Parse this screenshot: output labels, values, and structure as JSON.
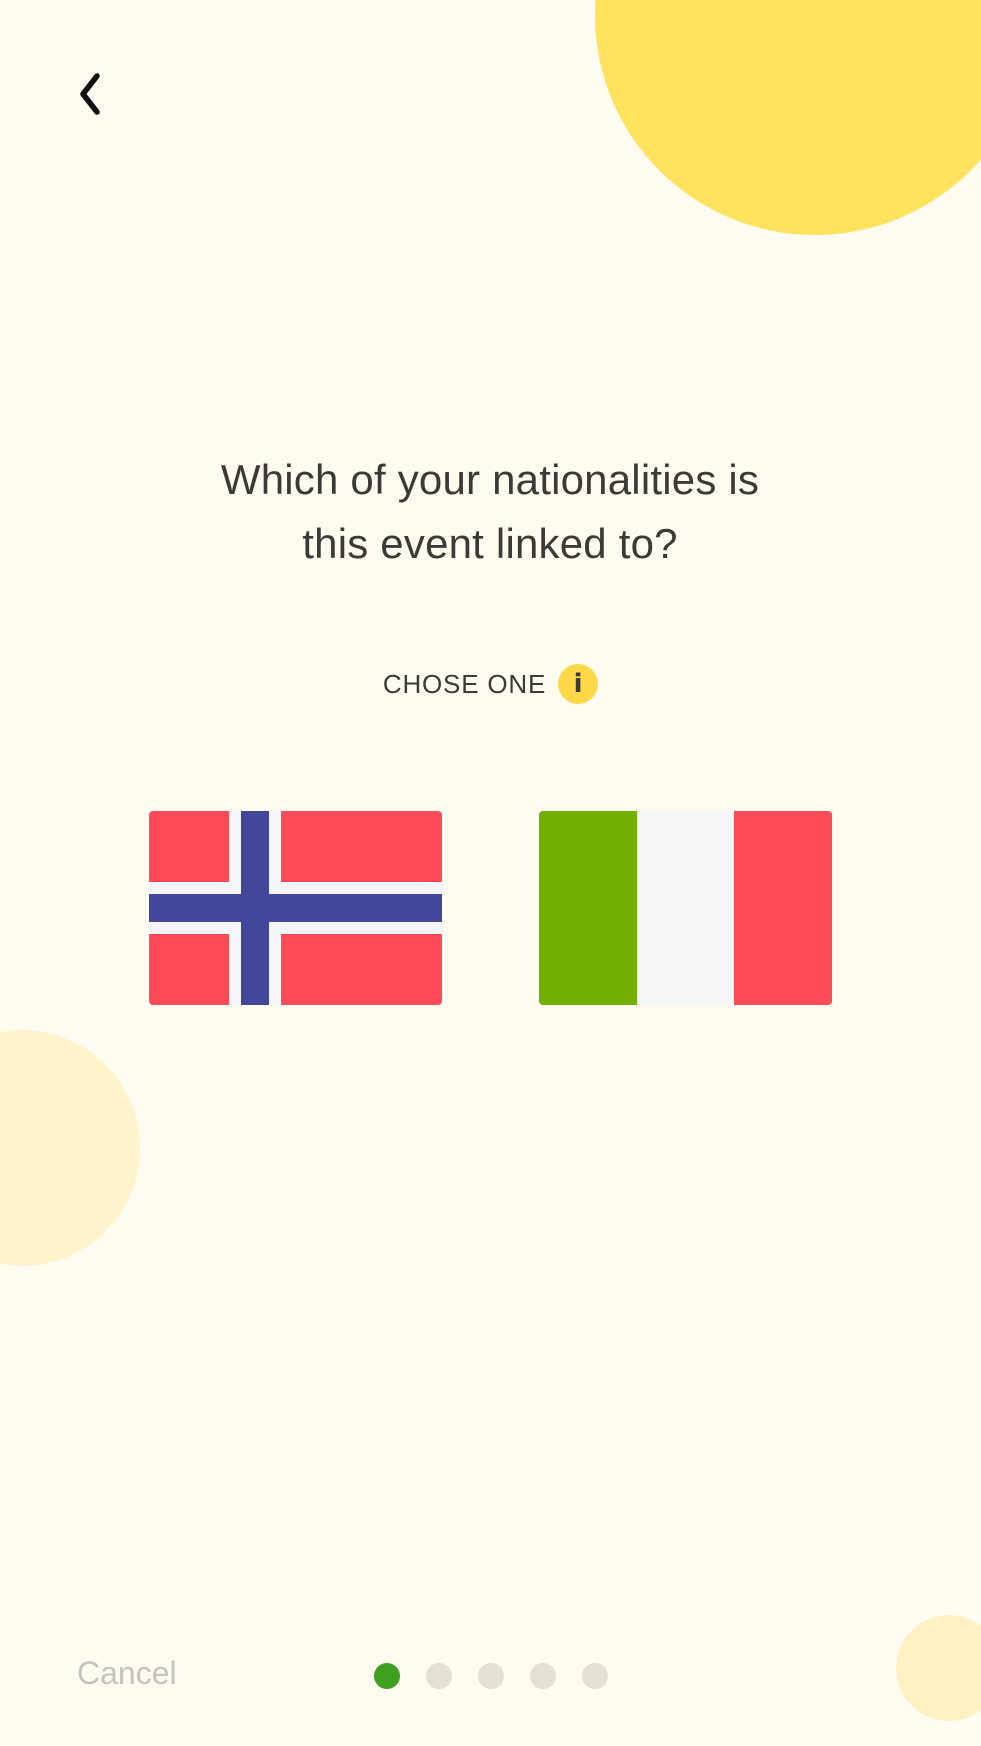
{
  "navigation": {
    "back_icon": "chevron-left-icon"
  },
  "question": {
    "line1": "Which of your nationalities is",
    "line2": "this event linked to?"
  },
  "choose": {
    "label": "CHOSE ONE",
    "info_icon_glyph": "i"
  },
  "options": [
    {
      "country": "Norway",
      "icon": "norway-flag-icon"
    },
    {
      "country": "Italy",
      "icon": "italy-flag-icon"
    }
  ],
  "footer": {
    "cancel_label": "Cancel",
    "progress": {
      "total_steps": 5,
      "current_step": 1
    }
  },
  "colors": {
    "background": "#fefbf0",
    "accent_yellow": "#ffe25e",
    "progress_active": "#3da01e",
    "progress_inactive": "#e2e1d3",
    "text": "#3b3a37",
    "cancel_text": "#c4c3bd"
  }
}
